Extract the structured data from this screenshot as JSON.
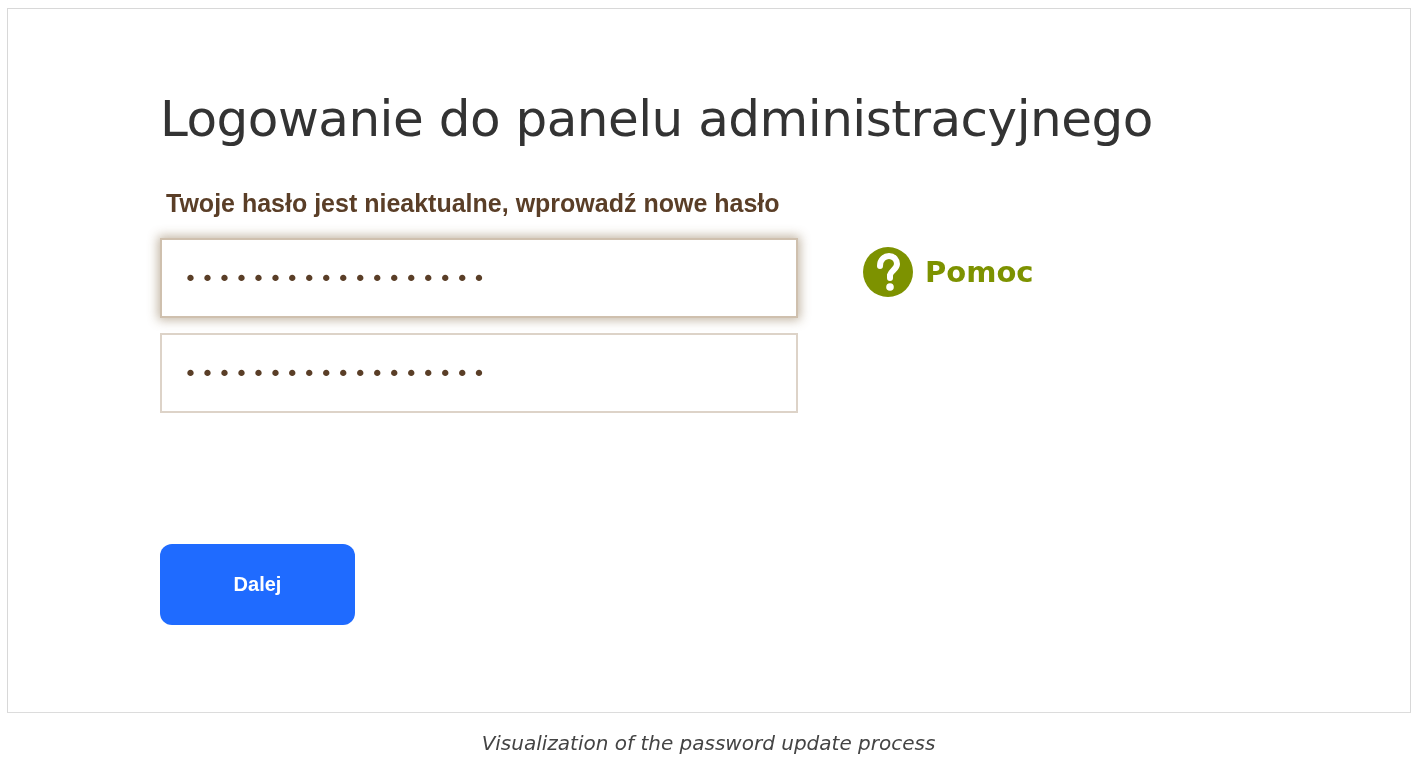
{
  "title": "Logowanie do panelu administracyjnego",
  "message": "Twoje hasło jest nieaktualne, wprowadź nowe hasło",
  "fields": [
    {
      "value": "••••••••••••••••••",
      "focused": true
    },
    {
      "value": "••••••••••••••••••",
      "focused": false
    }
  ],
  "help": {
    "label": "Pomoc"
  },
  "button": {
    "label": "Dalej"
  },
  "caption": "Visualization of the password update process"
}
